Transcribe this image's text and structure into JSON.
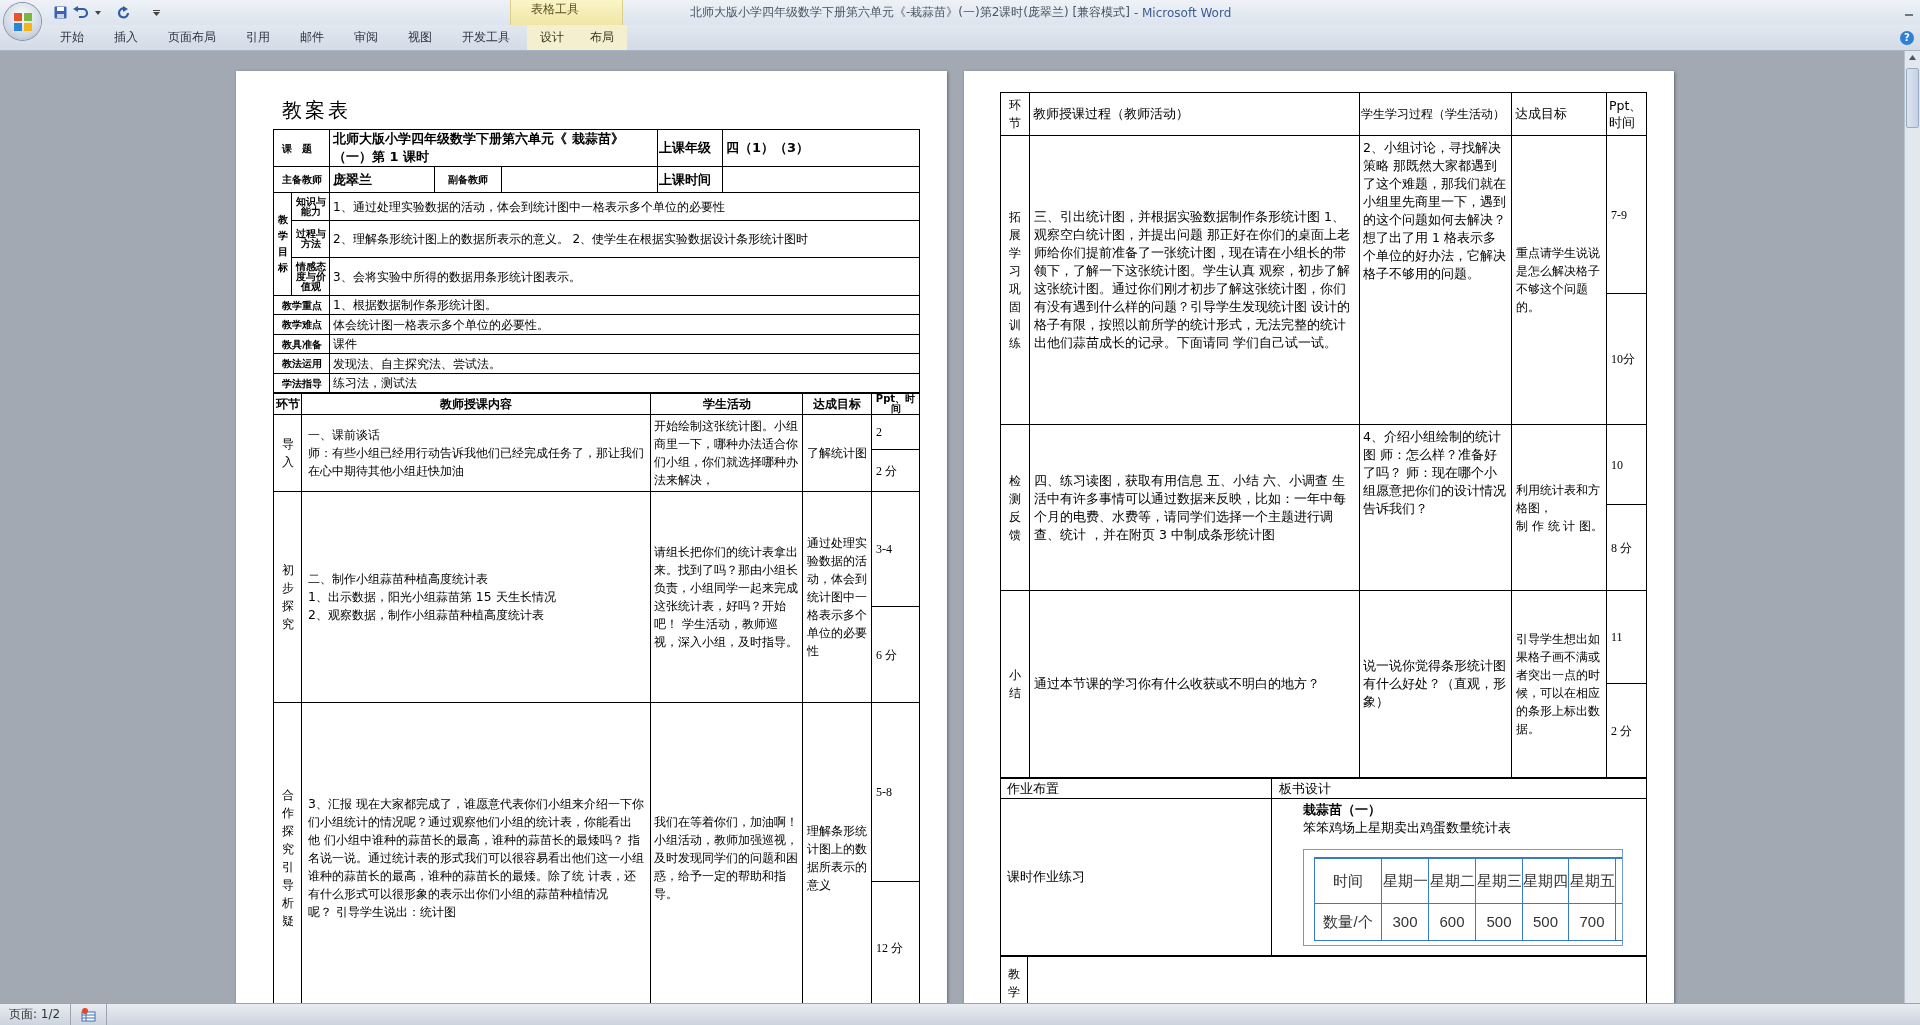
{
  "window": {
    "title": "北师大版小学四年级数学下册第六单元《-栽蒜苗》(一)第2课时(庞翠兰) [兼容模式]",
    "app": "- Microsoft Word",
    "contextual_group": "表格工具",
    "help": "?"
  },
  "ribbon_tabs": [
    {
      "label": "开始",
      "contextual": false
    },
    {
      "label": "插入",
      "contextual": false
    },
    {
      "label": "页面布局",
      "contextual": false
    },
    {
      "label": "引用",
      "contextual": false
    },
    {
      "label": "邮件",
      "contextual": false
    },
    {
      "label": "审阅",
      "contextual": false
    },
    {
      "label": "视图",
      "contextual": false
    },
    {
      "label": "开发工具",
      "contextual": false
    },
    {
      "label": "设计",
      "contextual": true
    },
    {
      "label": "布局",
      "contextual": true
    }
  ],
  "page_1": {
    "heading": "教案表",
    "topic": {
      "label": "课题",
      "value": "北师大版小学四年级数学下册第六单元《 栽蒜苗》（一）第 1 课时",
      "grade_label": "上课年级",
      "grade": "四（1）（3）"
    },
    "teachers": {
      "main_label": "主备教师",
      "main": "庞翠兰",
      "assistant_label": "副备教师",
      "time_label": "上课时间"
    },
    "objectives": {
      "label": "教学目标",
      "items": [
        {
          "label": "知识与能力",
          "text": "1、通过处理实验数据的活动，体会到统计图中一格表示多个单位的必要性"
        },
        {
          "label": "过程与方法",
          "text": "2、理解条形统计图上的数据所表示的意义。 2、使学生在根据实验数据设计条形统计图时"
        },
        {
          "label": "情感态度与价值观",
          "text": "3、会将实验中所得的数据用条形统计图表示。"
        }
      ]
    },
    "info_rows": [
      {
        "label": "教学重点",
        "text": "1、根据数据制作条形统计图。"
      },
      {
        "label": "教学难点",
        "text": "体会统计图一格表示多个单位的必要性。"
      },
      {
        "label": "教具准备",
        "text": "课件"
      },
      {
        "label": "教法运用",
        "text": "发现法、自主探究法、尝试法。"
      },
      {
        "label": "学法指导",
        "text": "练习法，测试法"
      }
    ],
    "columns": [
      "环节",
      "教师授课内容",
      "学生活动",
      "达成目标",
      "Ppt、时间"
    ],
    "rows": [
      {
        "stage": "导入",
        "teacher": [
          "一、课前谈话",
          "师：有些小组已经用行动告诉我他们已经完成任务了，那让我们在心中期待其他小组赶快加油"
        ],
        "student": [
          "开始绘制这张统计图。小组商里一下，哪种办法适合你们小组，你们就选择哪种办法来解决，"
        ],
        "goal": "了解统计图",
        "ppt": "2",
        "time": "2 分"
      },
      {
        "stage": "初步探究",
        "teacher": [
          "二、制作小组蒜苗种植高度统计表",
          "1、出示数据，阳光小组蒜苗第 15 天生长情况",
          "2、观察数据，制作小组蒜苗种植高度统计表"
        ],
        "student": [
          "请组长把你们的统计表拿出来。找到了吗？那由小组长负责，小组同学一起来完成这张统计表，好吗？开始吧！ 学生活动，教师巡视，深入小组，及时指导。"
        ],
        "goal": "通过处理实验数据的活动，体会到统计图中一格表示多个单位的必要性",
        "ppt": "3-4",
        "time": "6 分"
      },
      {
        "stage": "合作探究引导析疑",
        "teacher": [
          "3、汇报 现在大家都完成了，谁愿意代表你们小组来介绍一下你们小组统计的情况呢？通过观察他们小组的统计表，你能看出他 们小组中谁种的蒜苗长的最高，谁种的蒜苗长的最矮吗？ 指名说一说。通过统计表的形式我们可以很容易看出他们这一小组谁种的蒜苗长的最高，谁种的蒜苗长的最矮。除了统 计表，还有什么形式可以很形象的表示出你们小组的蒜苗种植情况呢？ 引导学生说出：统计图"
        ],
        "student": [
          "我们在等着你们，加油啊！",
          "小组活动，教师加强巡视，及时发现同学们的问题和困惑，给予一定的帮助和指导。"
        ],
        "goal": "理解条形统计图上的数据所表示的意义",
        "ppt": "5-8",
        "time": "12 分"
      }
    ]
  },
  "page_2": {
    "columns": [
      "环节",
      "教师授课过程（教师活动）",
      "学生学习过程（学生活动）",
      "达成目标",
      "Ppt、时间"
    ],
    "rows": [
      {
        "stage": "拓展学习巩固训练",
        "teacher": "三、引出统计图，并根据实验数据制作条形统计图 1、观察空白统计图，并提出问题 那正好在你们的桌面上老师给你们提前准备了一张统计图，现在请在小组长的带领下，了解一下这张统计图。学生认真 观察，初步了解这张统计图。通过你们刚才初步了解这张统计图，你们有没有遇到什么样的问题？引导学生发现统计图 设计的格子有限，按照以前所学的统计形式，无法完整的统计出他们蒜苗成长的记录。下面请同 学们自己试一试。",
        "student": "2、小组讨论，寻找解决策略 那既然大家都遇到了这个难题，那我们就在小组里先商里一下，遇到的这个问题如何去解决？想了出了用 1 格表示多个单位的好办法，它解决格子不够用的问题。",
        "goal": "重点请学生说说是怎么解决格子不够这个问题的。",
        "ppt": "7-9",
        "time": "10分"
      },
      {
        "stage": "检测反馈",
        "teacher": "四、练习读图，获取有用信息 五、小结 六、小调查 生活中有许多事情可以通过数据来反映，比如：一年中每个月的电费、水费等，请同学们选择一个主题进行调查、统计 ，并在附页 3 中制成条形统计图",
        "student": "4、介绍小组绘制的统计图 师：怎么样？准备好了吗？ 师：现在哪个小组愿意把你们的设计情况告诉我们？",
        "goal": "利用统计表和方格图，制 作 统 计 图。",
        "ppt": "10",
        "time": "8 分"
      },
      {
        "stage": "小结",
        "teacher": "通过本节课的学习你有什么收获或不明白的地方？",
        "student": "说一说你觉得条形统计图有什么好处？（直观，形象）",
        "goal": "引导学生想出如果格子画不满或者突出一点的时候，可以在相应的条形上标出数据。",
        "ppt": "11",
        "time": "2 分"
      }
    ],
    "homework": {
      "label": "作业布置",
      "text": "课时作业练习"
    },
    "board": {
      "label": "板书设计",
      "title": "栽蒜苗（一）",
      "subtitle": "笨笨鸡场上星期卖出鸡蛋数量统计表",
      "table": {
        "header": [
          "时间",
          "星期一",
          "星期二",
          "星期三",
          "星期四",
          "星期五"
        ],
        "row": [
          "数量/个",
          "300",
          "600",
          "500",
          "500",
          "700"
        ]
      }
    },
    "reflection": {
      "label": "教学"
    }
  },
  "status_bar": {
    "page": "页面: 1/2"
  }
}
